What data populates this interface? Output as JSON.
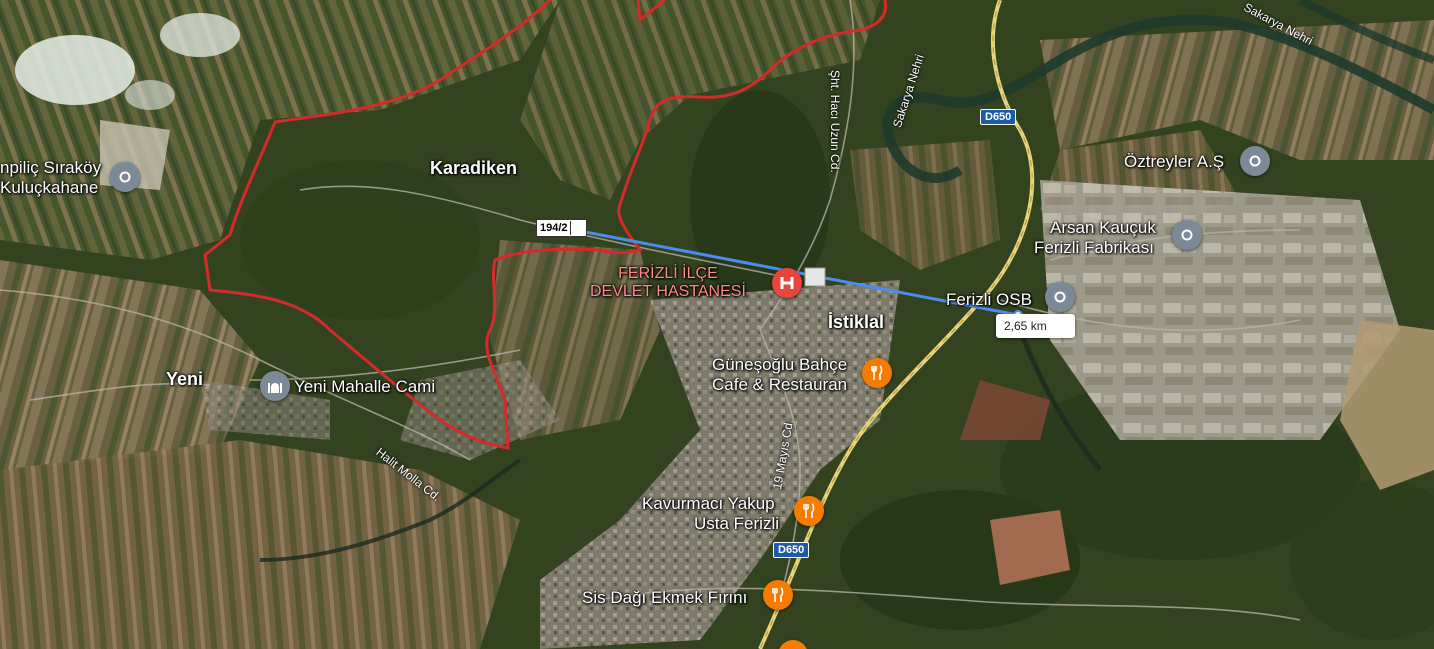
{
  "map": {
    "places": {
      "karadiken": "Karadiken",
      "yeni": "Yeni",
      "istiklal": "İstiklal"
    },
    "pois": {
      "hospital_line1": "FERİZLİ İLÇE",
      "hospital_line2": "DEVLET HASTANESİ",
      "piliç_line1": "npiliç Sıraköy",
      "piliç_line2": "Kuluçkahane",
      "oztreyler": "Öztreyler A.Ş",
      "arsan_line1": "Arsan Kauçuk",
      "arsan_line2": "Ferizli Fabrikası",
      "osb": "Ferizli OSB",
      "cami": "Yeni Mahalle Cami",
      "gunesoglu_line1": "Güneşoğlu Bahçe",
      "gunesoglu_line2": "Cafe & Restauran",
      "kavurmaci_line1": "Kavurmacı Yakup",
      "kavurmaci_line2": "Usta Ferizli",
      "firin": "Sis Dağı Ekmek Fırını"
    },
    "roads": {
      "haci_uzun": "Şht. Hacı Uzun Cd.",
      "sakarya": "Sakarya Nehri",
      "sakarya_top": "Sakarya Nehri",
      "halit_molla": "Halit Molla Cd.",
      "mayis": "19 Mayıs Cd.",
      "d650_top": "D650",
      "d650_bottom": "D650"
    },
    "parcel_label": "194/2",
    "distance_label": "2,65 km",
    "colors": {
      "boundary": "#d42a2a",
      "measure_line": "#4a8df0",
      "highway": "#e8d27a"
    }
  }
}
